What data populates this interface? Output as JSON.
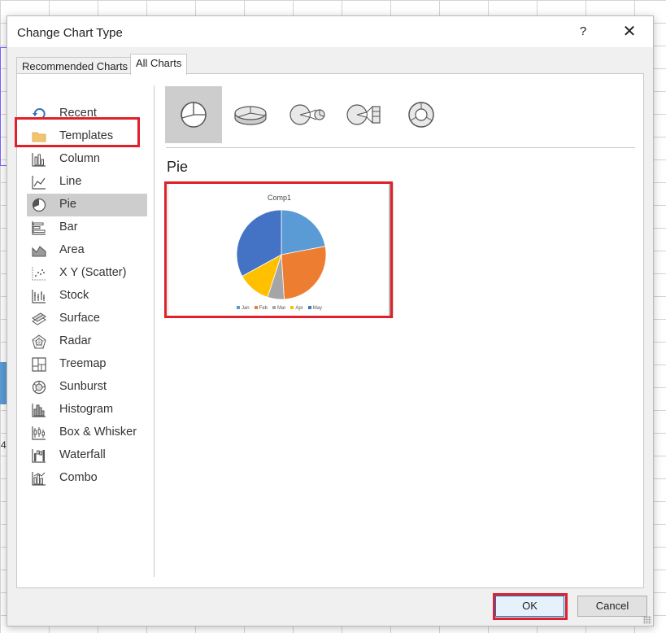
{
  "dialog": {
    "title": "Change Chart Type",
    "help_label": "?",
    "close_label": "✕"
  },
  "tabs": [
    {
      "label": "Recommended Charts",
      "active": false
    },
    {
      "label": "All Charts",
      "active": true
    }
  ],
  "categories": [
    {
      "label": "Recent",
      "icon": "recent-icon"
    },
    {
      "label": "Templates",
      "icon": "folder-icon"
    },
    {
      "label": "Column",
      "icon": "column-chart-icon"
    },
    {
      "label": "Line",
      "icon": "line-chart-icon"
    },
    {
      "label": "Pie",
      "icon": "pie-chart-icon",
      "selected": true
    },
    {
      "label": "Bar",
      "icon": "bar-chart-icon"
    },
    {
      "label": "Area",
      "icon": "area-chart-icon"
    },
    {
      "label": "X Y (Scatter)",
      "icon": "scatter-chart-icon"
    },
    {
      "label": "Stock",
      "icon": "stock-chart-icon"
    },
    {
      "label": "Surface",
      "icon": "surface-chart-icon"
    },
    {
      "label": "Radar",
      "icon": "radar-chart-icon"
    },
    {
      "label": "Treemap",
      "icon": "treemap-chart-icon"
    },
    {
      "label": "Sunburst",
      "icon": "sunburst-chart-icon"
    },
    {
      "label": "Histogram",
      "icon": "histogram-chart-icon"
    },
    {
      "label": "Box & Whisker",
      "icon": "box-whisker-chart-icon"
    },
    {
      "label": "Waterfall",
      "icon": "waterfall-chart-icon"
    },
    {
      "label": "Combo",
      "icon": "combo-chart-icon"
    }
  ],
  "subtypes": [
    {
      "icon": "pie-2d-icon",
      "selected": true
    },
    {
      "icon": "pie-3d-icon"
    },
    {
      "icon": "pie-of-pie-icon"
    },
    {
      "icon": "bar-of-pie-icon"
    },
    {
      "icon": "doughnut-icon"
    }
  ],
  "selected_type_label": "Pie",
  "preview": {
    "title": "Comp1"
  },
  "chart_data": {
    "type": "pie",
    "title": "Comp1",
    "categories": [
      "Jan",
      "Feb",
      "Mar",
      "Apr",
      "May"
    ],
    "values": [
      22,
      27,
      6,
      12,
      33
    ],
    "colors": [
      "#5b9bd5",
      "#ed7d31",
      "#a5a5a5",
      "#ffc000",
      "#4472c4"
    ],
    "legend": "bottom"
  },
  "buttons": {
    "ok": "OK",
    "cancel": "Cancel"
  },
  "colors": {
    "highlight": "#e0202a",
    "selection": "#cdcdcd",
    "ok_border": "#0078d7"
  }
}
